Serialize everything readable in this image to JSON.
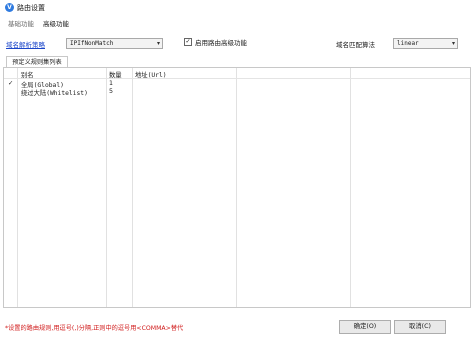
{
  "window": {
    "title": "路由设置",
    "icon": "app-logo-icon"
  },
  "tabs": [
    {
      "label": "基础功能",
      "active": false
    },
    {
      "label": "高级功能",
      "active": true
    }
  ],
  "options": {
    "domain_strategy_label": "域名解析策略",
    "domain_strategy_value": "IPIfNonMatch",
    "enable_advanced_label": "启用路由高级功能",
    "enable_advanced_checked": true,
    "domain_matcher_label": "域名匹配算法",
    "domain_matcher_value": "linear"
  },
  "subtab": {
    "label": "预定义规则集列表"
  },
  "table": {
    "columns": [
      "别名",
      "数量",
      "地址(Url)"
    ],
    "rows": [
      {
        "check": "✓",
        "alias": "全局(Global)",
        "count": "1",
        "url": ""
      },
      {
        "check": "",
        "alias": "绕过大陆(Whitelist)",
        "count": "5",
        "url": ""
      }
    ]
  },
  "footer": {
    "note": "*设置的路由规则,用逗号(,)分隔,正则中的逗号用<COMMA>替代",
    "ok_label": "确定(O)",
    "cancel_label": "取消(C)"
  },
  "colors": {
    "link": "#1a45c9",
    "note": "#d01818",
    "accent": "#2f7be0"
  }
}
